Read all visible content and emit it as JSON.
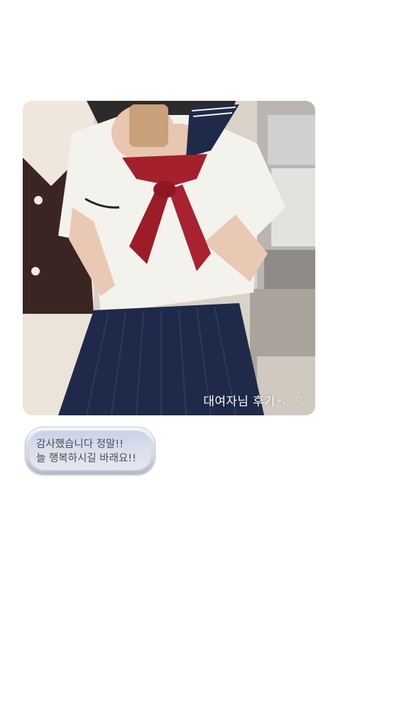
{
  "review_card": {
    "photo_description_icon": "photo-of-uniform",
    "caption": {
      "text": "대여자님 후기",
      "sparkle": "⁺˖.",
      "heart": "♡"
    }
  },
  "message_bubble": {
    "line1": "감사했습니다 정말!!",
    "line2": "늘 행복하시길 바래요!!"
  },
  "colors": {
    "background": "#ffffff",
    "skirt": "#1f2a4a",
    "ribbon": "#a3202c",
    "shirt": "#f3f1ec",
    "bubble_text": "#4a4e5c"
  }
}
